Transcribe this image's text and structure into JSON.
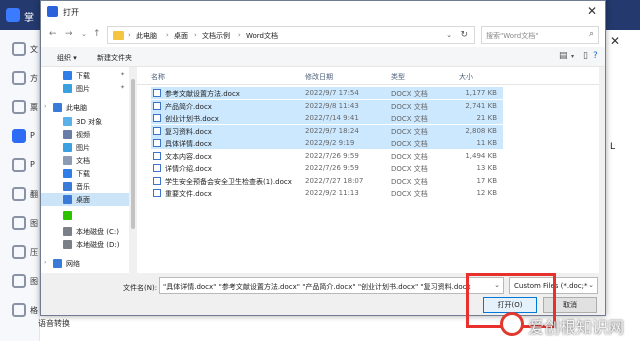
{
  "background": {
    "app_name": "掌",
    "sidebar": [
      "文",
      "方",
      "票",
      "P",
      "P",
      "翻",
      "图",
      "压",
      "图",
      "格"
    ],
    "bottom_text": "语音转换",
    "right_letter": "L"
  },
  "dialog": {
    "title": "打开",
    "breadcrumb": [
      "此电脑",
      "桌面",
      "文档示例",
      "Word文档"
    ],
    "search_placeholder": "搜索\"Word文档\"",
    "toolbar": {
      "organize": "组织 ▾",
      "new_folder": "新建文件夹"
    },
    "nav_items": [
      {
        "label": "下载",
        "icon": "download-icon",
        "color": "#2e7de9",
        "indent": 1,
        "pin": true
      },
      {
        "label": "图片",
        "icon": "picture-icon",
        "color": "#3aa0e0",
        "indent": 1,
        "pin": true
      },
      {
        "label": "此电脑",
        "icon": "computer-icon",
        "color": "#3b7bd8",
        "indent": 0,
        "expand": true
      },
      {
        "label": "3D 对象",
        "icon": "cube-icon",
        "color": "#5ab0e8",
        "indent": 1
      },
      {
        "label": "视频",
        "icon": "video-icon",
        "color": "#6a7da8",
        "indent": 1
      },
      {
        "label": "图片",
        "icon": "picture-icon",
        "color": "#3aa0e0",
        "indent": 1
      },
      {
        "label": "文档",
        "icon": "document-icon",
        "color": "#8b9bb4",
        "indent": 1
      },
      {
        "label": "下载",
        "icon": "download-icon",
        "color": "#2e7de9",
        "indent": 1
      },
      {
        "label": "音乐",
        "icon": "music-icon",
        "color": "#3b7bd8",
        "indent": 1
      },
      {
        "label": "桌面",
        "icon": "desktop-icon",
        "color": "#3b7bd8",
        "indent": 1,
        "selected": true
      },
      {
        "label": "",
        "icon": "wechat-icon",
        "color": "#2dc100",
        "indent": 1
      },
      {
        "label": "本地磁盘 (C:)",
        "icon": "drive-icon",
        "color": "#7a7f88",
        "indent": 1
      },
      {
        "label": "本地磁盘 (D:)",
        "icon": "drive-icon",
        "color": "#7a7f88",
        "indent": 1
      },
      {
        "label": "网络",
        "icon": "network-icon",
        "color": "#3b7bd8",
        "indent": 0,
        "expand": true
      }
    ],
    "columns": {
      "name": "名称",
      "date": "修改日期",
      "type": "类型",
      "size": "大小"
    },
    "files": [
      {
        "name": "参考文献设置方法.docx",
        "date": "2022/9/7 17:54",
        "type": "DOCX 文档",
        "size": "1,177 KB",
        "selected": true
      },
      {
        "name": "产品简介.docx",
        "date": "2022/9/8 11:43",
        "type": "DOCX 文档",
        "size": "2,741 KB",
        "selected": true
      },
      {
        "name": "创业计划书.docx",
        "date": "2022/7/14 9:41",
        "type": "DOCX 文档",
        "size": "21 KB",
        "selected": true
      },
      {
        "name": "复习资料.docx",
        "date": "2022/9/7 18:24",
        "type": "DOCX 文档",
        "size": "2,808 KB",
        "selected": true
      },
      {
        "name": "具体详情.docx",
        "date": "2022/9/2 9:19",
        "type": "DOCX 文档",
        "size": "11 KB",
        "selected": true
      },
      {
        "name": "文本内容.docx",
        "date": "2022/7/26 9:59",
        "type": "DOCX 文档",
        "size": "1,494 KB",
        "selected": false
      },
      {
        "name": "详情介绍.docx",
        "date": "2022/7/26 9:59",
        "type": "DOCX 文档",
        "size": "13 KB",
        "selected": false
      },
      {
        "name": "学生安全预备会安全卫生检查表(1).docx",
        "date": "2022/7/27 18:07",
        "type": "DOCX 文档",
        "size": "17 KB",
        "selected": false
      },
      {
        "name": "重要文件.docx",
        "date": "2022/9/2 11:13",
        "type": "DOCX 文档",
        "size": "12 KB",
        "selected": false
      }
    ],
    "filename_label": "文件名(N):",
    "filename_value": "\"具体详情.docx\" \"参考文献设置方法.docx\" \"产品简介.docx\" \"创业计划书.docx\" \"复习资料.docx",
    "filetype_value": "Custom Files (*.doc;*.docx)",
    "open_button": "打开(O)",
    "cancel_button": "取消"
  },
  "watermark": "爱创根知识网",
  "colors": {
    "highlight": "#e8312c",
    "selection": "#cce8ff",
    "title_bg": "#243a6e"
  }
}
